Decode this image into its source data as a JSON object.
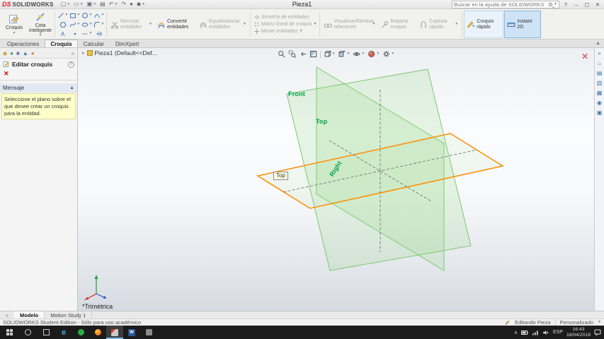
{
  "colors": {
    "brand_red": "#d22027",
    "accent_blue": "#2d77b8",
    "plane_edge_green": "#7cc96f",
    "plane_highlight_orange": "#ff8c00",
    "plane_label_green": "#00a14b",
    "message_bg_yellow": "#feffc9",
    "taskbar_bg": "#1b1b1b"
  },
  "title_bar": {
    "logo_mark": "DS",
    "logo_text": "SOLIDWORKS",
    "document_title": "Pieza1",
    "search_placeholder": "Buscar en la ayuda de SOLIDWORKS",
    "help_label": "?",
    "quick_access_icons": [
      "new-document",
      "open-document",
      "save",
      "print",
      "undo",
      "redo",
      "rebuild",
      "options"
    ],
    "window_buttons": {
      "minimize": "–",
      "maximize": "▢",
      "close": "✕"
    }
  },
  "ribbon": {
    "groups": {
      "sketch": "Croquis",
      "smart_dimension": "Cota inteligente",
      "trim": "Recortar entidades",
      "convert": "Convertir entidades",
      "offset": "Equidistanciar entidades",
      "mirror": "Simetría de entidades",
      "linear_pattern": "Matriz lineal de croquis",
      "move": "Mover entidades",
      "relations": "Visualizar/Eliminar relaciones",
      "repair": "Reparar croquis",
      "quick_snaps": "Captura rápida",
      "rapid_sketch": "Croquis rápido",
      "instant_2d": "Instant 2D"
    },
    "sketch_tools": [
      "line",
      "corner-rectangle",
      "circle",
      "arc",
      "polygon",
      "spline",
      "ellipse",
      "sketch-fillet",
      "text",
      "point",
      "centerline",
      "mirror-entities"
    ]
  },
  "command_tabs": {
    "items": [
      {
        "label": "Operaciones"
      },
      {
        "label": "Croquis"
      },
      {
        "label": "Calcular"
      },
      {
        "label": "DimXpert"
      }
    ],
    "active": "Croquis"
  },
  "left_panel": {
    "manager_tabs": [
      "featuremanager",
      "propertymanager",
      "configurationmanager",
      "dimxpertmanager",
      "displaymanager"
    ],
    "title": "Editar croquis",
    "help_label": "?",
    "cancel_label": "✕",
    "message": {
      "header": "Mensaje",
      "text": "Seleccione el plano sobre el que desee crear un croquis para la entidad."
    }
  },
  "viewport": {
    "feature_tree_flyout": "Pieza1 (Default<<Def...",
    "plane_labels": {
      "front": "Front",
      "top": "Top",
      "right": "Right"
    },
    "tooltip": "Top",
    "view_orientation_name": "*Trimétrica",
    "hud_icons": [
      "zoom-to-fit",
      "zoom-to-area",
      "previous-view",
      "section-view",
      "view-orientation",
      "display-style",
      "hide-show-items",
      "edit-appearance",
      "view-settings"
    ]
  },
  "right_task_pane": {
    "icons": [
      "collapse-pane",
      "solidworks-resources",
      "design-library",
      "file-explorer",
      "view-palette",
      "appearances",
      "custom-properties"
    ]
  },
  "model_tabs": {
    "items": [
      {
        "label": "Modelo"
      },
      {
        "label": "Motion Study 1"
      }
    ],
    "active": "Modelo"
  },
  "status_bar": {
    "license_text": "SOLIDWORKS Student Edition - Sólo para uso académico",
    "editing_status": "Editando Pieza",
    "display_state": "Personalizado"
  },
  "taskbar": {
    "apps": [
      "edge",
      "green-app",
      "firefox",
      "solidworks",
      "word",
      "generic-app"
    ],
    "active_app": "solidworks",
    "tray": {
      "language": "ESP",
      "time": "16:43",
      "date": "18/04/2018"
    }
  }
}
